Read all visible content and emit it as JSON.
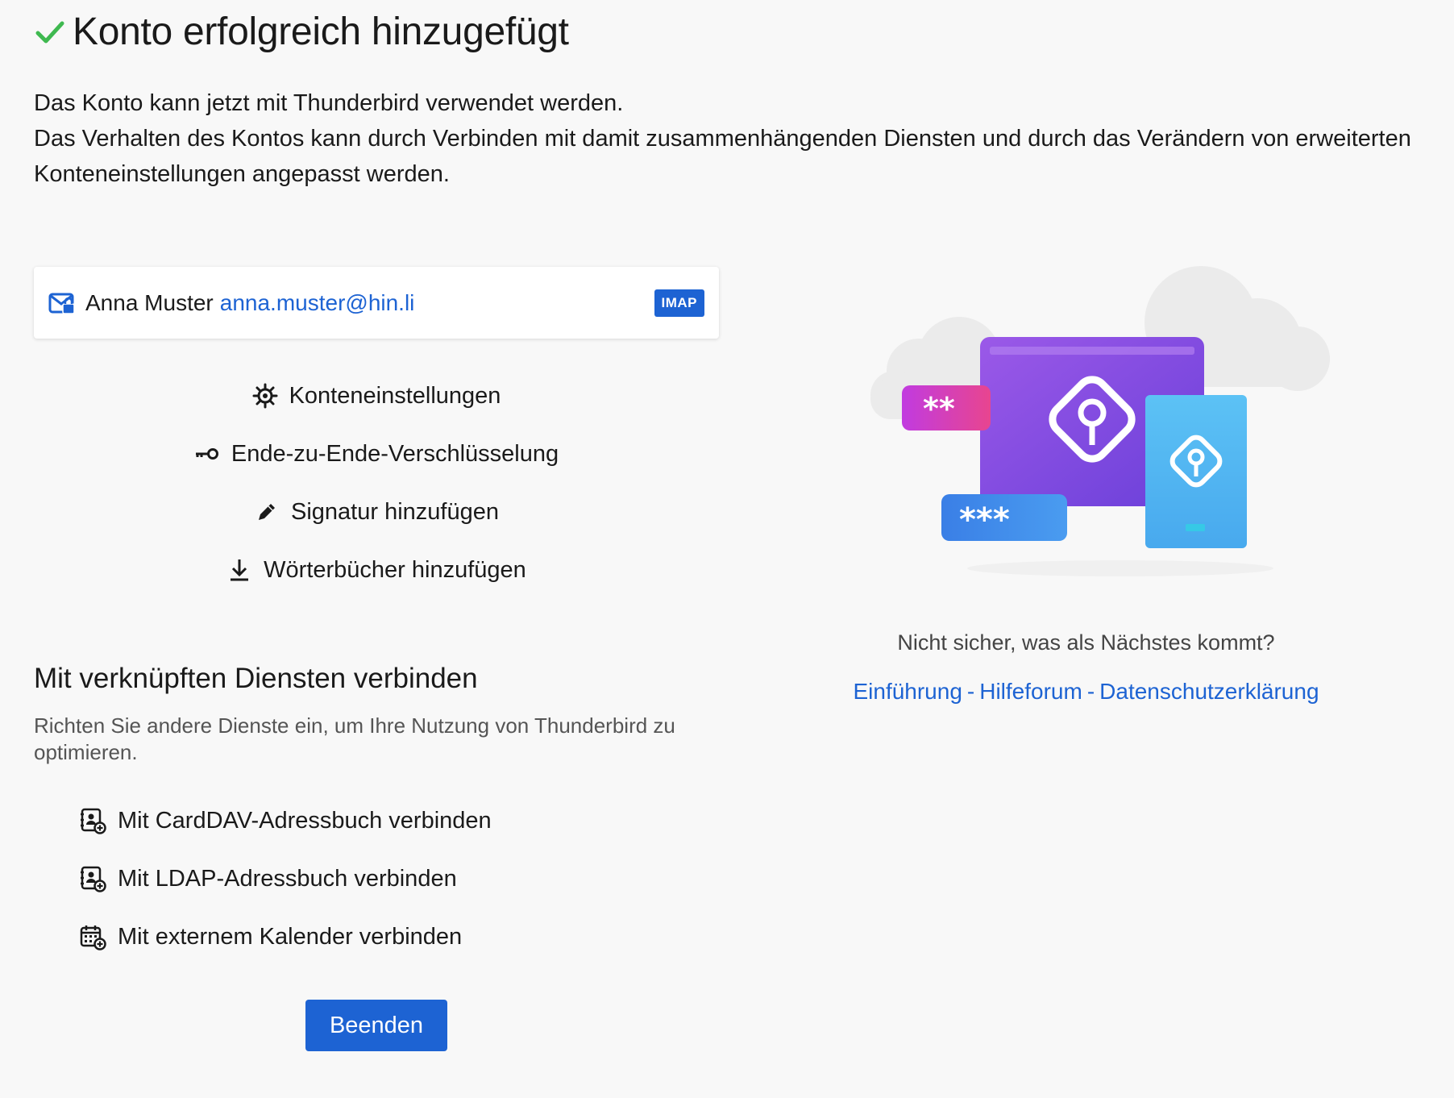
{
  "header": {
    "title": "Konto erfolgreich hinzugefügt"
  },
  "intro": {
    "line1": "Das Konto kann jetzt mit Thunderbird verwendet werden.",
    "line2": "Das Verhalten des Kontos kann durch Verbinden mit damit zusammenhängenden Diensten und durch das Verändern von erweiterten Konteneinstellungen angepasst werden."
  },
  "account": {
    "name": "Anna Muster",
    "email": "anna.muster@hin.li",
    "type_badge": "IMAP"
  },
  "actions": [
    {
      "label": "Konteneinstellungen",
      "icon": "gear-icon"
    },
    {
      "label": "Ende-zu-Ende-Verschlüsselung",
      "icon": "key-icon"
    },
    {
      "label": "Signatur hinzufügen",
      "icon": "pencil-icon"
    },
    {
      "label": "Wörterbücher hinzufügen",
      "icon": "download-icon"
    }
  ],
  "connect": {
    "title": "Mit verknüpften Diensten verbinden",
    "description": "Richten Sie andere Dienste ein, um Ihre Nutzung von Thunderbird zu optimieren.",
    "services": [
      {
        "label": "Mit CardDAV-Adressbuch verbinden",
        "icon": "address-book-add-icon"
      },
      {
        "label": "Mit LDAP-Adressbuch verbinden",
        "icon": "address-book-add-icon"
      },
      {
        "label": "Mit externem Kalender verbinden",
        "icon": "calendar-add-icon"
      }
    ]
  },
  "finish_button": "Beenden",
  "help": {
    "question": "Nicht sicher, was als Nächstes kommt?",
    "links": [
      "Einführung",
      "Hilfeforum",
      "Datenschutzerklärung"
    ],
    "separator": "-"
  },
  "illustration": {
    "password_short": "**",
    "password_long": "***"
  },
  "colors": {
    "accent": "#1d63d3",
    "success": "#2ea44f",
    "background": "#f8f8f8"
  }
}
